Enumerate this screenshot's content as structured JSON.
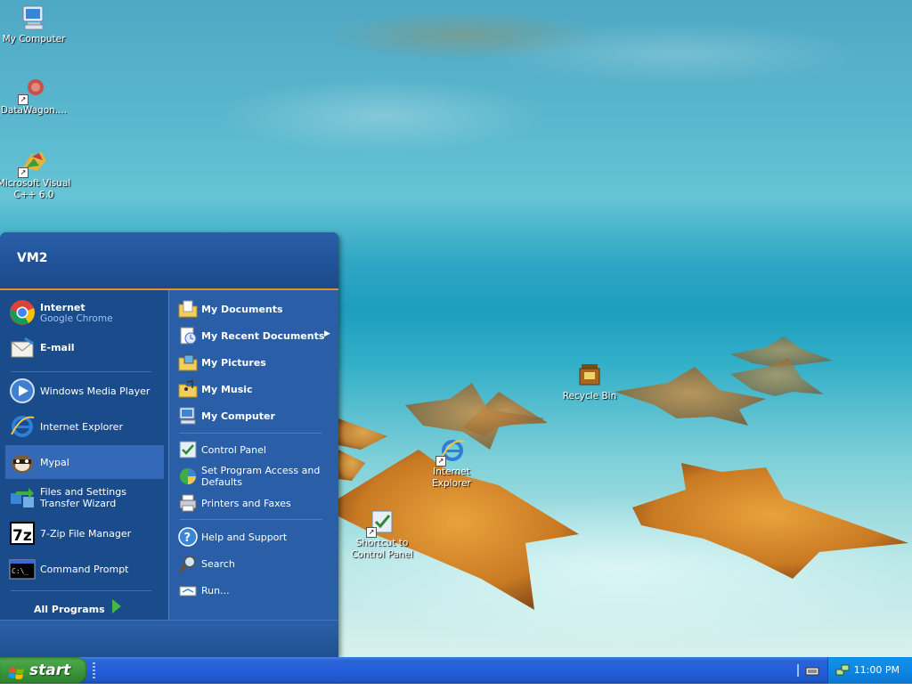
{
  "desktop": {
    "icons": [
      {
        "label": "My Computer",
        "icon": "my-computer-icon"
      },
      {
        "label": "DataWagon....",
        "icon": "datawagon-icon"
      },
      {
        "label": "Microsoft Visual C++ 6.0",
        "icon": "visual-cpp-icon"
      },
      {
        "label": "Recycle Bin",
        "icon": "recycle-bin-icon"
      },
      {
        "label": "Internet Explorer",
        "icon": "internet-explorer-icon"
      },
      {
        "label": "Shortcut to Control Panel",
        "icon": "control-panel-icon"
      }
    ]
  },
  "start_menu": {
    "user": "VM2",
    "pinned": [
      {
        "title": "Internet",
        "subtitle": "Google Chrome",
        "icon": "chrome-icon"
      },
      {
        "title": "E-mail",
        "icon": "email-icon"
      }
    ],
    "recent": [
      {
        "label": "Windows Media Player",
        "icon": "media-player-icon"
      },
      {
        "label": "Internet Explorer",
        "icon": "internet-explorer-icon"
      },
      {
        "label": "Mypal",
        "icon": "mypal-icon",
        "highlighted": true
      },
      {
        "label": "Files and Settings Transfer Wizard",
        "icon": "transfer-wizard-icon"
      },
      {
        "label": "7-Zip File Manager",
        "icon": "7zip-icon"
      },
      {
        "label": "Command Prompt",
        "icon": "command-prompt-icon"
      }
    ],
    "all_programs": "All Programs",
    "places": [
      {
        "label": "My Documents",
        "icon": "folder-documents-icon"
      },
      {
        "label": "My Recent Documents",
        "icon": "recent-documents-icon"
      },
      {
        "label": "My Pictures",
        "icon": "folder-pictures-icon"
      },
      {
        "label": "My Music",
        "icon": "folder-music-icon"
      },
      {
        "label": "My Computer",
        "icon": "my-computer-icon"
      }
    ],
    "system": [
      {
        "label": "Control Panel",
        "icon": "control-panel-icon"
      },
      {
        "label": "Set Program Access and Defaults",
        "icon": "program-access-icon"
      },
      {
        "label": "Printers and Faxes",
        "icon": "printer-icon"
      }
    ],
    "help": [
      {
        "label": "Help and Support",
        "icon": "help-icon"
      },
      {
        "label": "Search",
        "icon": "search-icon"
      },
      {
        "label": "Run...",
        "icon": "run-icon"
      }
    ]
  },
  "taskbar": {
    "start_label": "start",
    "clock": "11:00 PM"
  },
  "colors": {
    "taskbar_blue": "#245edb",
    "start_green": "#399539",
    "menu_left": "#1a4b8a",
    "menu_right": "#2a5ea6",
    "highlight": "#3469b8",
    "header_accent": "#e98d2c"
  }
}
